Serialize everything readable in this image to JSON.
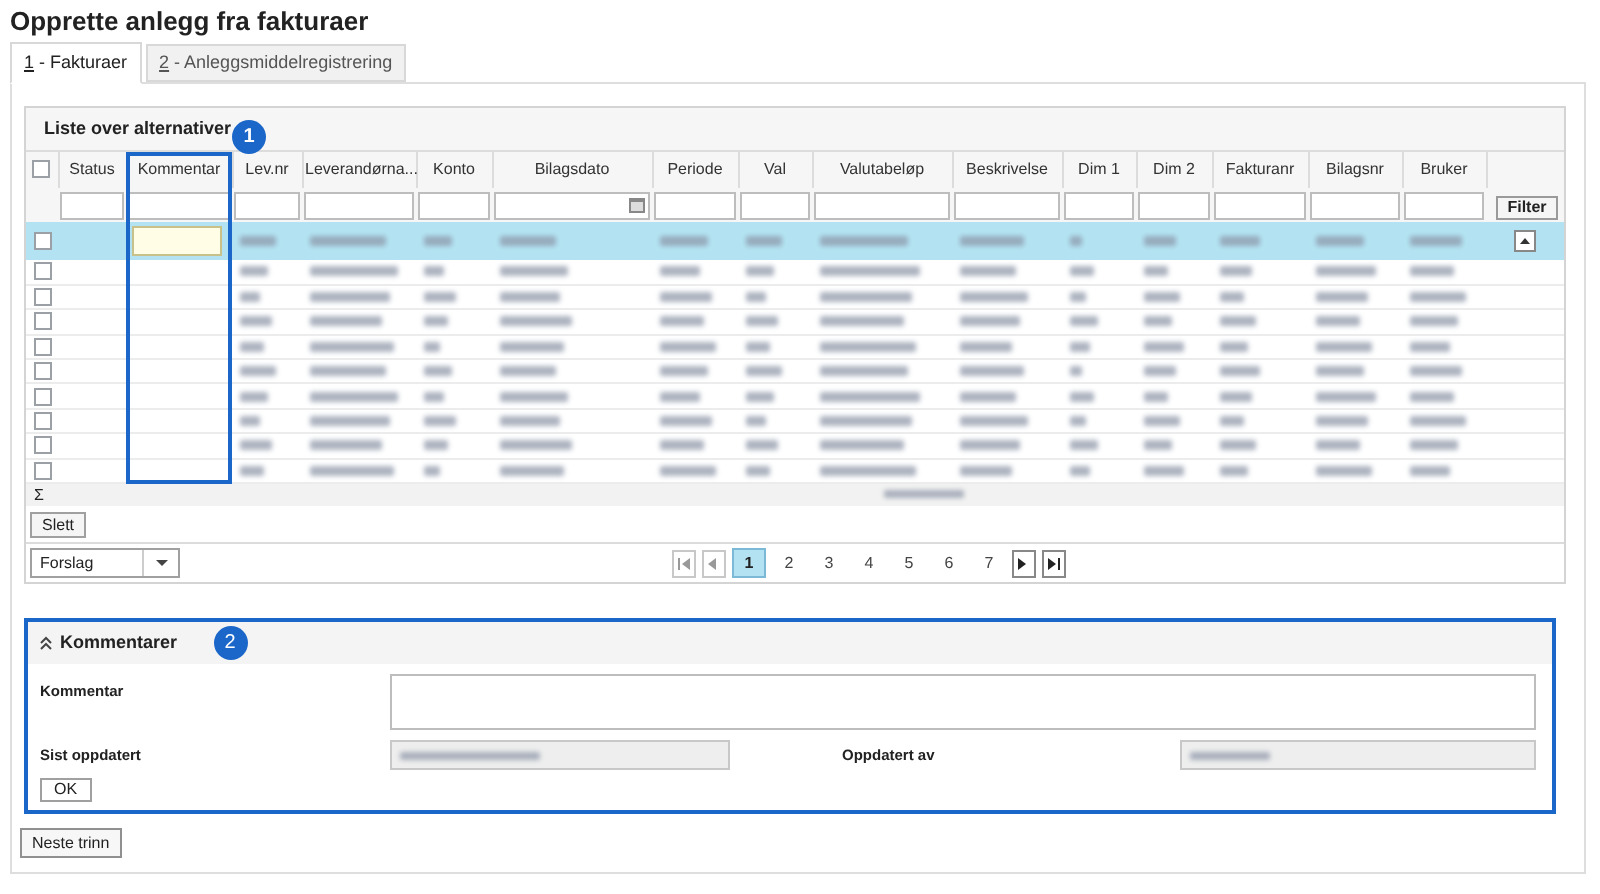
{
  "page_title": "Opprette anlegg fra fakturaer",
  "tabs": [
    {
      "number": "1",
      "label": " - Fakturaer",
      "selected": true
    },
    {
      "number": "2",
      "label": " - Anleggsmiddelregistrering",
      "selected": false
    }
  ],
  "grid": {
    "title": "Liste over alternativer",
    "callout": "1",
    "all_checked": false,
    "columns": [
      {
        "label": "Status",
        "kind": "text"
      },
      {
        "label": "Kommentar",
        "kind": "text"
      },
      {
        "label": "Lev.nr",
        "kind": "text"
      },
      {
        "label": "Leverandørna...",
        "kind": "text"
      },
      {
        "label": "Konto",
        "kind": "text"
      },
      {
        "label": "Bilagsdato",
        "kind": "date"
      },
      {
        "label": "Periode",
        "kind": "text"
      },
      {
        "label": "Val",
        "kind": "text"
      },
      {
        "label": "Valutabeløp",
        "kind": "text"
      },
      {
        "label": "Beskrivelse",
        "kind": "text"
      },
      {
        "label": "Dim 1",
        "kind": "text"
      },
      {
        "label": "Dim 2",
        "kind": "text"
      },
      {
        "label": "Fakturanr",
        "kind": "text"
      },
      {
        "label": "Bilagsnr",
        "kind": "text"
      },
      {
        "label": "Bruker",
        "kind": "text"
      }
    ],
    "filter_button": "Filter",
    "rows": [
      {
        "selected": true,
        "checked": false
      },
      {
        "selected": false,
        "checked": false
      },
      {
        "selected": false,
        "checked": false
      },
      {
        "selected": false,
        "checked": false
      },
      {
        "selected": false,
        "checked": false
      },
      {
        "selected": false,
        "checked": false
      },
      {
        "selected": false,
        "checked": false
      },
      {
        "selected": false,
        "checked": false
      },
      {
        "selected": false,
        "checked": false
      },
      {
        "selected": false,
        "checked": false
      }
    ],
    "sum_symbol": "Σ",
    "delete_button": "Slett",
    "view_select": {
      "value": "Forslag"
    },
    "pages": [
      {
        "label": "1",
        "selected": true
      },
      {
        "label": "2",
        "selected": false
      },
      {
        "label": "3",
        "selected": false
      },
      {
        "label": "4",
        "selected": false
      },
      {
        "label": "5",
        "selected": false
      },
      {
        "label": "6",
        "selected": false
      },
      {
        "label": "7",
        "selected": false
      }
    ]
  },
  "comments": {
    "title": "Kommentarer",
    "callout": "2",
    "expanded": true,
    "comment_label": "Kommentar",
    "updated_label": "Sist oppdatert",
    "updated_by_label": "Oppdatert av",
    "ok_button": "OK"
  },
  "next_button": "Neste trinn"
}
